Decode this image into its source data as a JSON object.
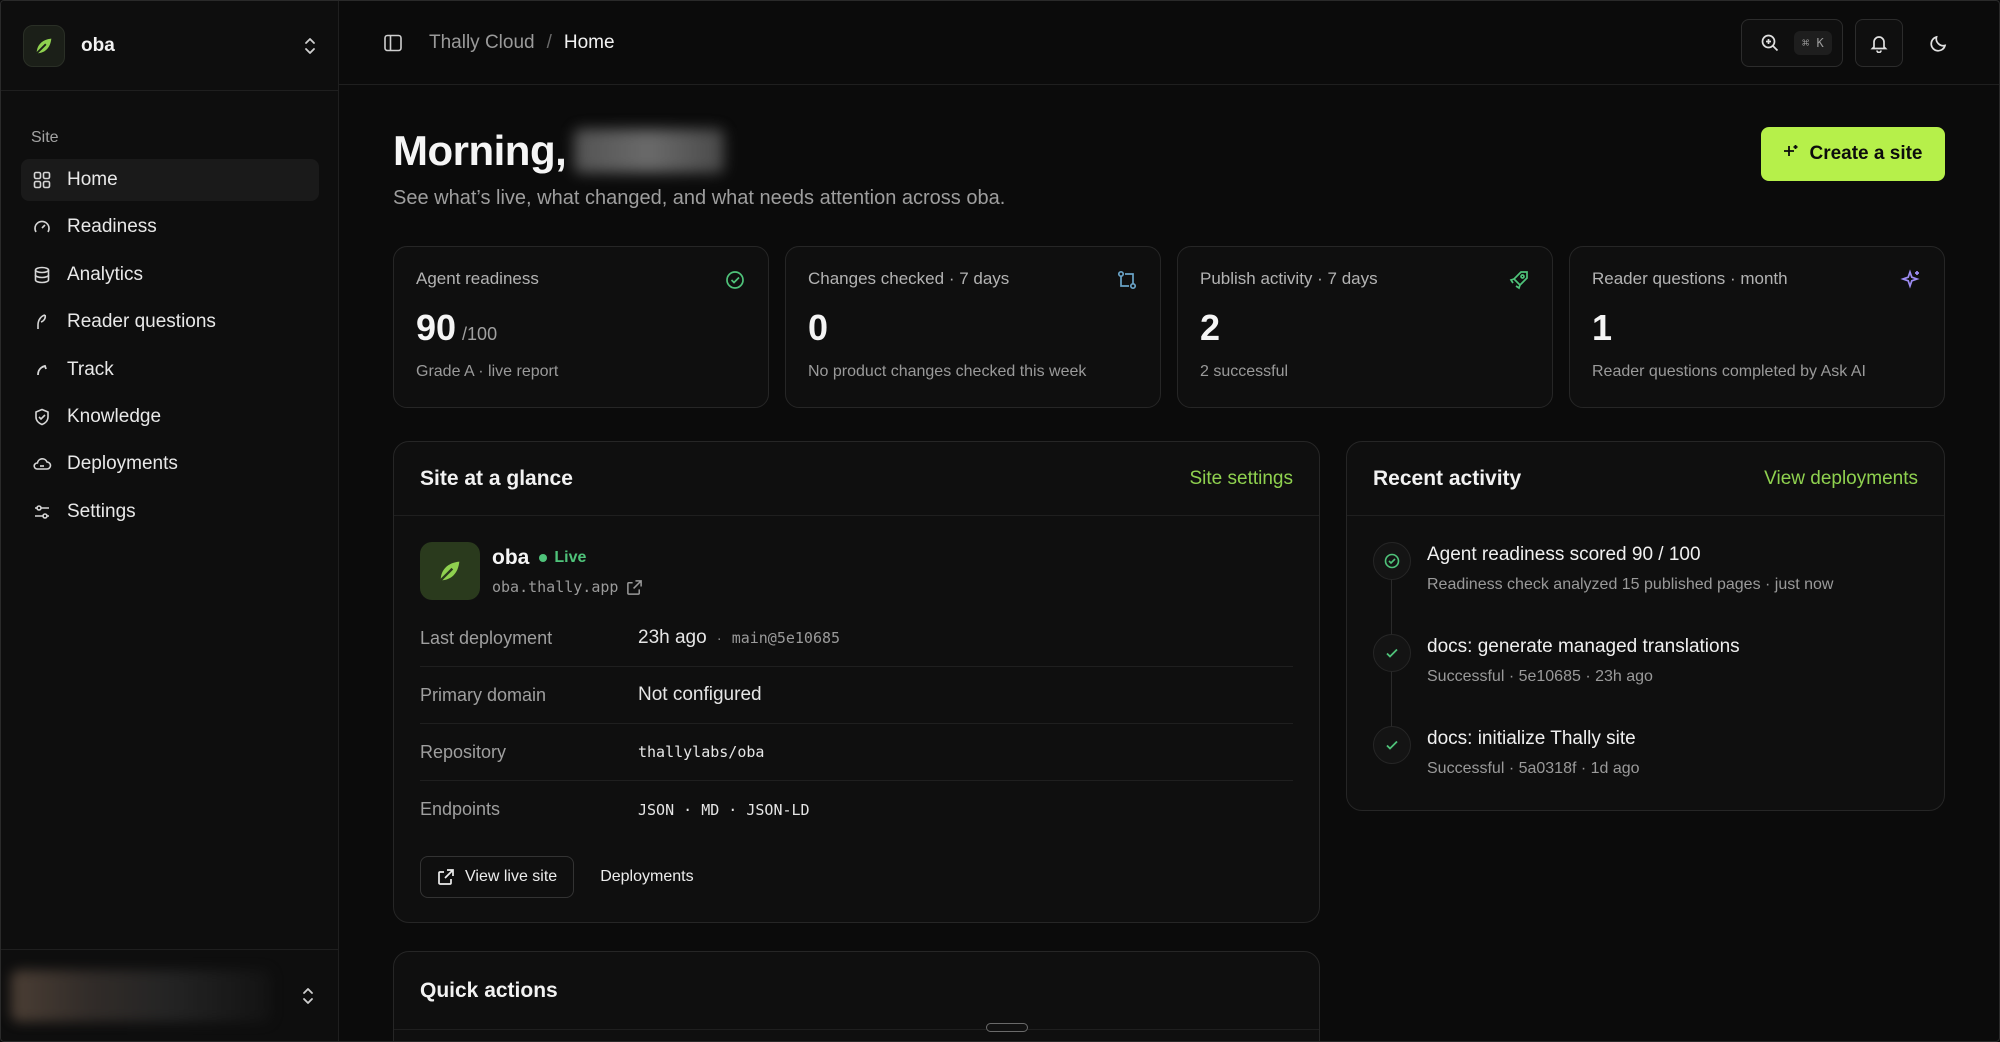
{
  "sidebar": {
    "org_name": "oba",
    "section_label": "Site",
    "items": [
      {
        "label": "Home",
        "icon": "grid-icon"
      },
      {
        "label": "Readiness",
        "icon": "gauge-icon"
      },
      {
        "label": "Analytics",
        "icon": "database-icon"
      },
      {
        "label": "Reader questions",
        "icon": "feather-icon"
      },
      {
        "label": "Track",
        "icon": "track-icon"
      },
      {
        "label": "Knowledge",
        "icon": "shield-check-icon"
      },
      {
        "label": "Deployments",
        "icon": "cloud-icon"
      },
      {
        "label": "Settings",
        "icon": "sliders-icon"
      }
    ]
  },
  "topbar": {
    "breadcrumb_root": "Thally Cloud",
    "breadcrumb_sep": "/",
    "breadcrumb_current": "Home",
    "search_shortcut": "⌘ K"
  },
  "header": {
    "greeting": "Morning,",
    "subtitle": "See what’s live, what changed, and what needs attention across oba.",
    "create_label": "Create a site"
  },
  "stats": [
    {
      "label": "Agent readiness",
      "value": "90",
      "suffix": "/100",
      "note": "Grade A · live report",
      "icon": "check-circle-icon"
    },
    {
      "label": "Changes checked · 7 days",
      "value": "0",
      "suffix": "",
      "note": "No product changes checked this week",
      "icon": "git-compare-icon"
    },
    {
      "label": "Publish activity · 7 days",
      "value": "2",
      "suffix": "",
      "note": "2 successful",
      "icon": "rocket-icon"
    },
    {
      "label": "Reader questions · month",
      "value": "1",
      "suffix": "",
      "note": "Reader questions completed by Ask AI",
      "icon": "sparkles-icon"
    }
  ],
  "glance": {
    "title": "Site at a glance",
    "link": "Site settings",
    "site_name": "oba",
    "status": "Live",
    "url": "oba.thally.app",
    "rows": [
      {
        "key": "Last deployment",
        "value": "23h ago",
        "sep": "·",
        "ref": "main@5e10685"
      },
      {
        "key": "Primary domain",
        "value": "Not configured"
      },
      {
        "key": "Repository",
        "value": "thallylabs/oba"
      },
      {
        "key": "Endpoints",
        "value": "JSON · MD · JSON-LD"
      }
    ],
    "view_live_label": "View live site",
    "deployments_label": "Deployments"
  },
  "recent": {
    "title": "Recent activity",
    "link": "View deployments",
    "items": [
      {
        "title": "Agent readiness scored 90 / 100",
        "meta": "Readiness check analyzed 15 published pages · just now"
      },
      {
        "title": "docs: generate managed translations",
        "meta": "Successful · 5e10685 · 23h ago"
      },
      {
        "title": "docs: initialize Thally site",
        "meta": "Successful · 5a0318f · 1d ago"
      }
    ]
  },
  "quick": {
    "title": "Quick actions"
  },
  "colors": {
    "accent": "#b6f04a",
    "link": "#8fd14f",
    "live": "#4fc37a",
    "background": "#0b0b0b"
  }
}
